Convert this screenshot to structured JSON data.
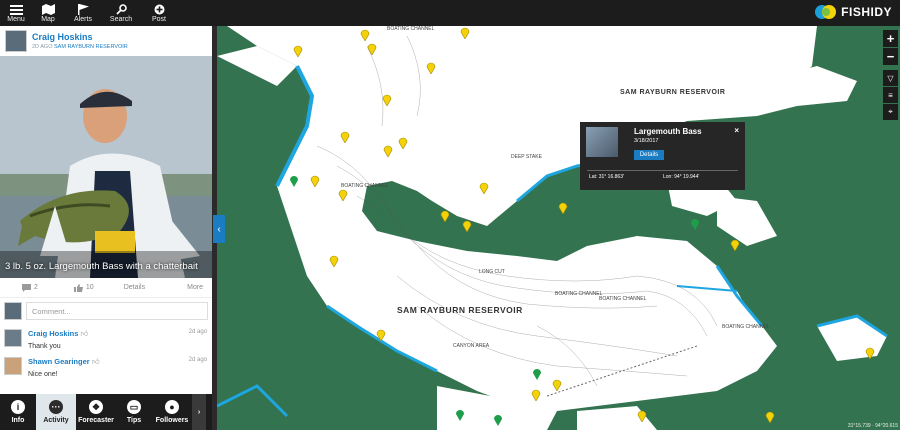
{
  "topbar": {
    "menu_label": "Menu",
    "map_label": "Map",
    "alerts_label": "Alerts",
    "search_label": "Search",
    "post_label": "Post",
    "brand": "FISHIDY"
  },
  "post": {
    "author": "Craig Hoskins",
    "ago": "2D AGO",
    "location": "SAM RAYBURN RESERVOIR",
    "caption": "3 lb. 5 oz. Largemouth Bass with a chatterbait",
    "comments_count": "2",
    "likes_count": "10",
    "details_label": "Details",
    "more_label": "More",
    "comment_placeholder": "Comment...",
    "comments": [
      {
        "author": "Craig Hoskins",
        "text": "Thank you",
        "time": "2d ago"
      },
      {
        "author": "Shawn Gearinger",
        "text": "Nice one!",
        "time": "2d ago"
      }
    ]
  },
  "tabs": {
    "info": "Info",
    "activity": "Activity",
    "forecaster": "Forecaster",
    "tips": "Tips",
    "followers": "Followers"
  },
  "map": {
    "labels": {
      "reservoir_main": "SAM RAYBURN RESERVOIR",
      "reservoir_top": "SAM RAYBURN RESERVOIR",
      "boating_channel_1": "BOATING CHANNEL",
      "boating_channel_2": "BOATING CHANNEL",
      "boating_channel_3": "BOATING CHANNEL",
      "boating_channel_4": "BOATING CHANNEL",
      "boating_channel_5": "BOATING CHANNEL",
      "long_cut": "LONG CUT",
      "canyon_area": "CANYON AREA",
      "deep_stake": "DEEP STAKE"
    },
    "zoom_in": "+",
    "zoom_out": "−",
    "coords_readout": "31°15.739 · 94°20.615"
  },
  "popup": {
    "title": "Largemouth Bass",
    "date": "3/18/2017",
    "details_label": "Details",
    "close_label": "×",
    "lat": "Lat: 31° 16.863'",
    "lon": "Lon: 94° 19.944'"
  },
  "colors": {
    "accent": "#1a7cc2",
    "water": "#ffffff",
    "land": "#2d6b4a",
    "pin": "#f4d20a",
    "pin_green": "#1e9e4a"
  }
}
